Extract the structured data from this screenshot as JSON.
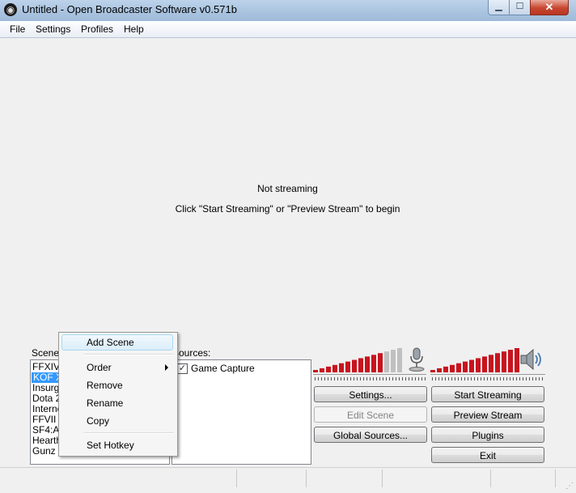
{
  "window": {
    "title": "Untitled - Open Broadcaster Software v0.571b",
    "minimize_glyph": "▁",
    "maximize_glyph": "☐",
    "close_glyph": "✕"
  },
  "menu": [
    "File",
    "Settings",
    "Profiles",
    "Help"
  ],
  "preview": {
    "status": "Not streaming",
    "hint": "Click \"Start Streaming\" or \"Preview Stream\" to begin"
  },
  "scenes": {
    "label": "Scenes:",
    "items": [
      "FFXIV",
      "KOF X",
      "Insurge",
      "Dota 2",
      "Interne",
      "FFVII",
      "SF4:AE",
      "Hearth",
      "Gunz 2"
    ],
    "selected_index": 1
  },
  "sources": {
    "label": "Sources:",
    "items": [
      {
        "label": "Game Capture",
        "checked": true,
        "check_glyph": "✓"
      }
    ]
  },
  "buttons": {
    "settings": "Settings...",
    "edit_scene": "Edit Scene",
    "global_sources": "Global Sources...",
    "start_streaming": "Start Streaming",
    "preview_stream": "Preview Stream",
    "plugins": "Plugins",
    "exit": "Exit"
  },
  "audio": {
    "mic_level": 0.75,
    "desktop_level": 1.0,
    "meter_color": "#c8141e",
    "meter_inactive_color": "#c0c0c0"
  },
  "context_menu": {
    "items": [
      "Add Scene",
      "Order",
      "Remove",
      "Rename",
      "Copy",
      "Set Hotkey"
    ],
    "highlighted": "Add Scene"
  }
}
